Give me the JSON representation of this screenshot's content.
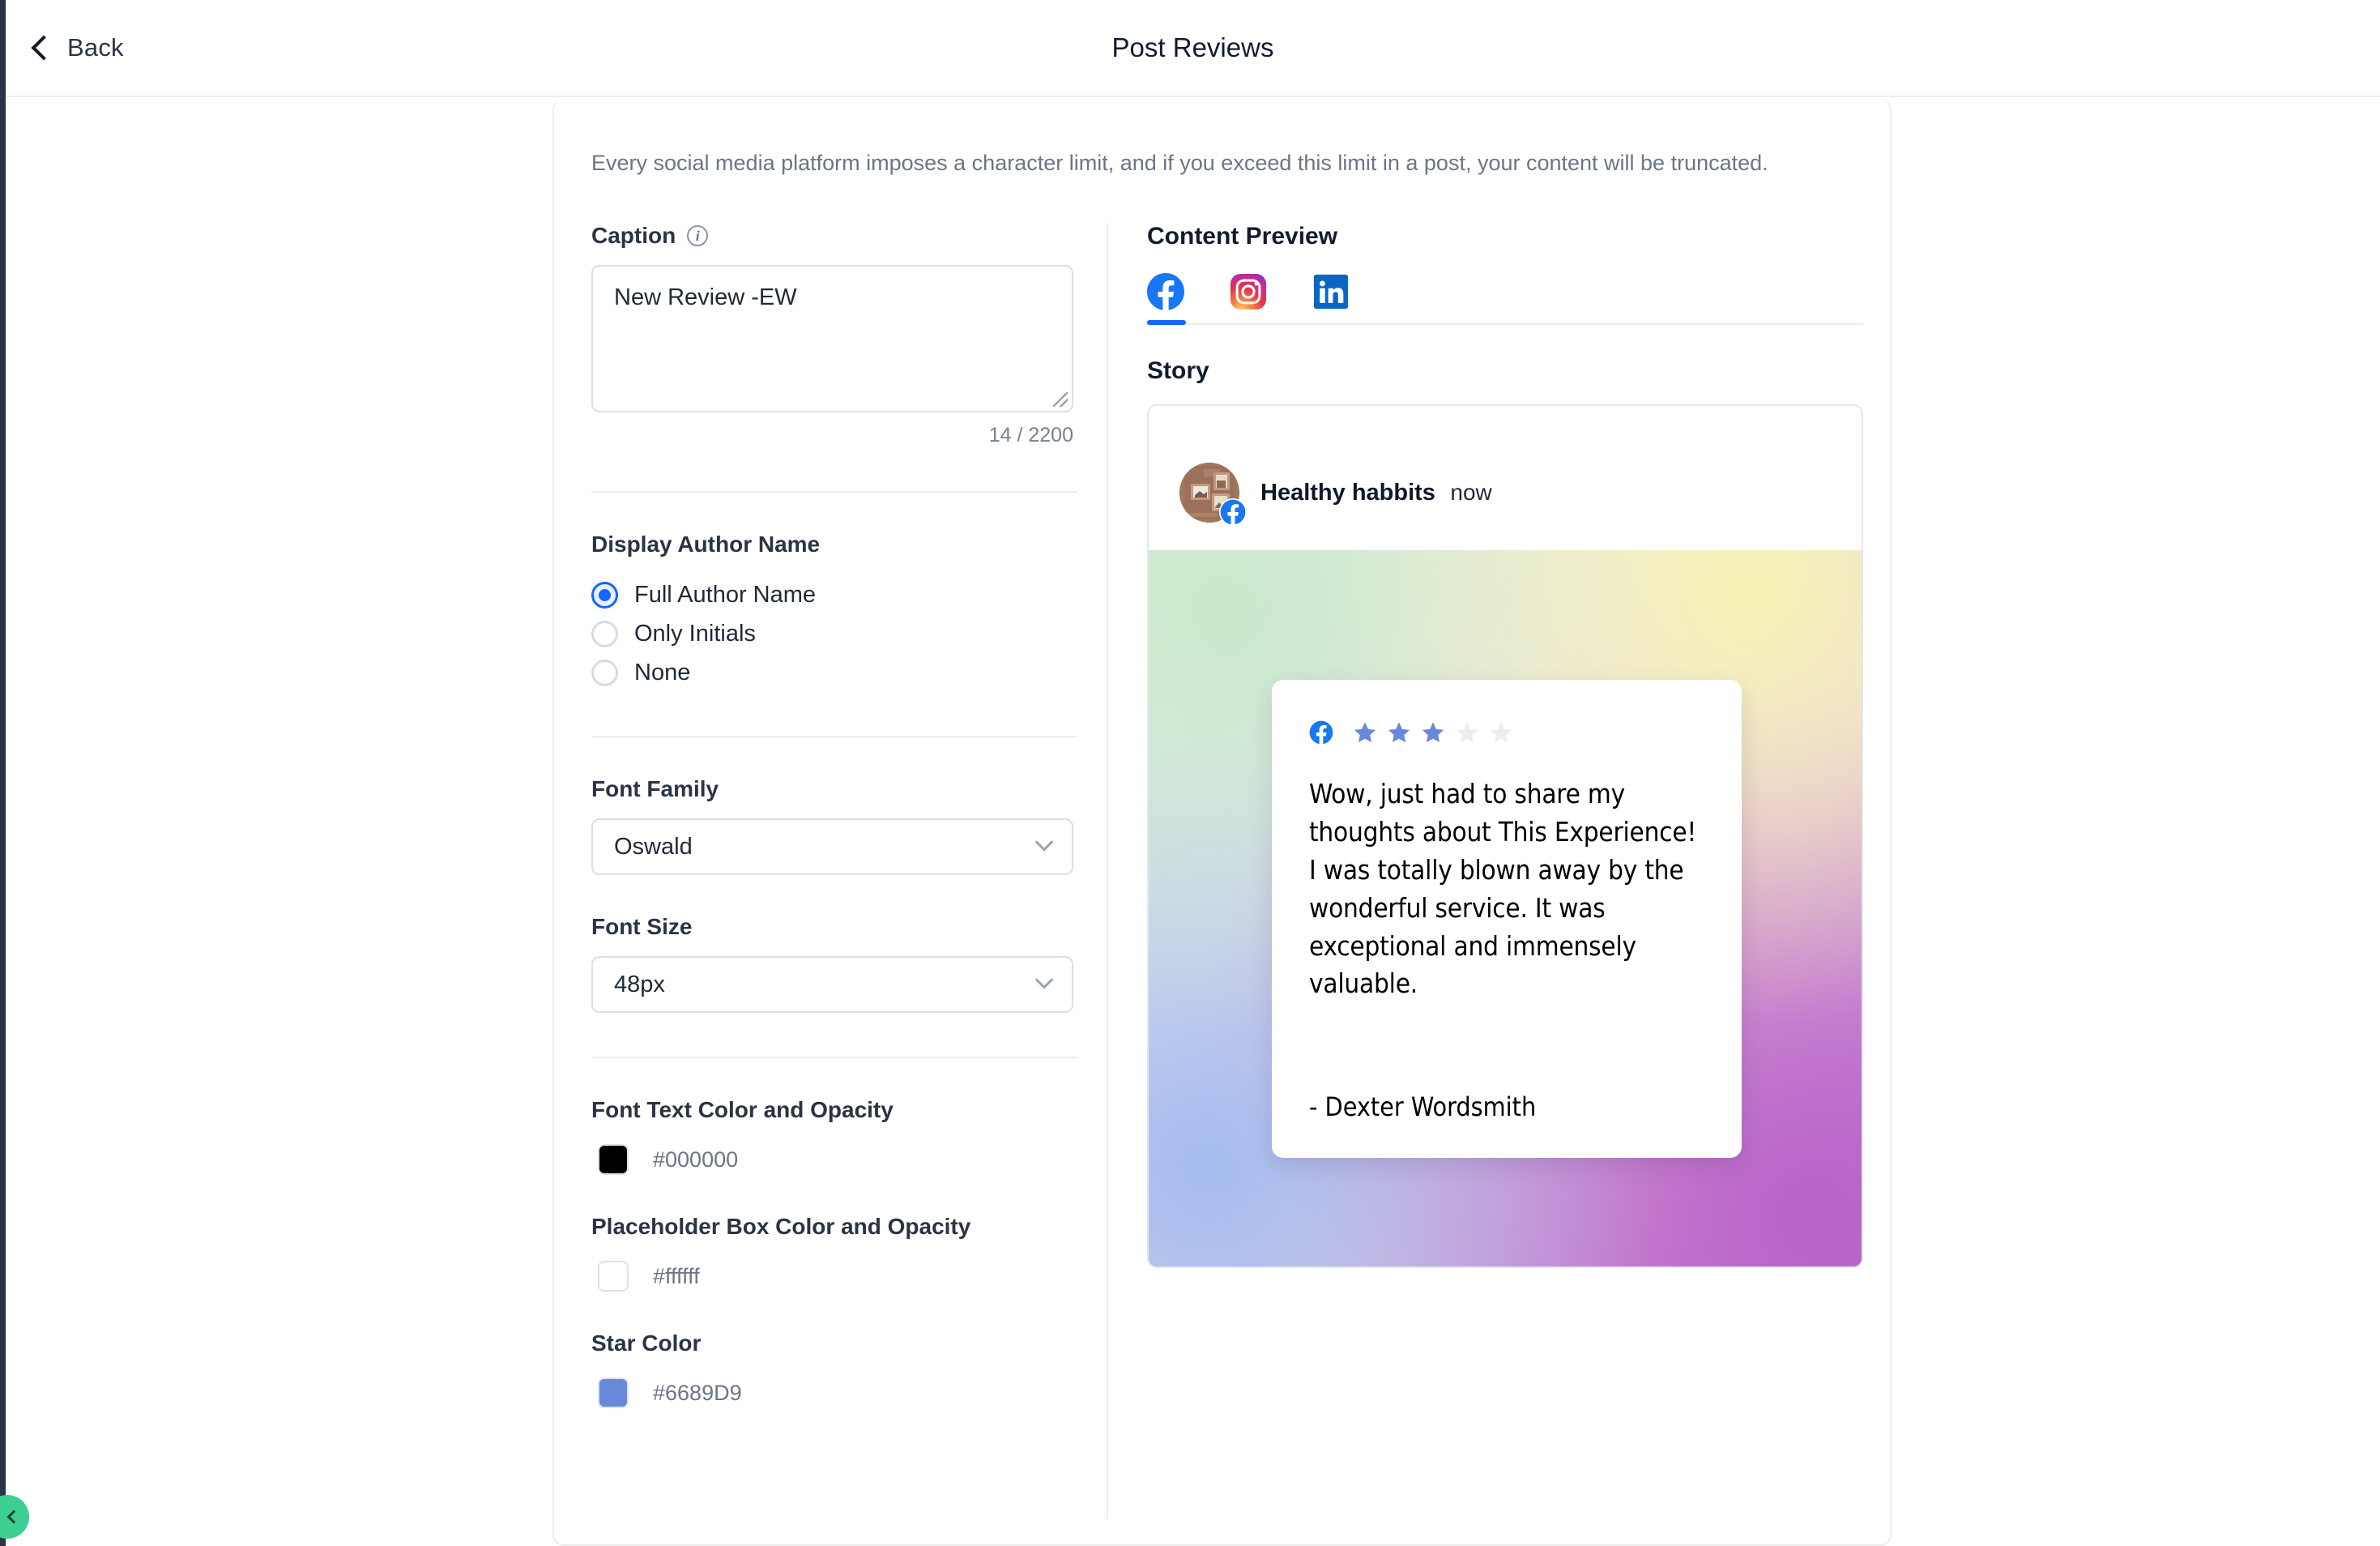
{
  "topbar": {
    "back_label": "Back",
    "title": "Post Reviews",
    "back_icon": "chevron-left-icon"
  },
  "notice": "Every social media platform imposes a character limit, and if you exceed this limit in a post, your content will be truncated.",
  "form": {
    "caption": {
      "label": "Caption",
      "info_icon": "info-icon",
      "value": "New Review -EW",
      "placeholder": "",
      "char_count": "14 / 2200"
    },
    "display_author": {
      "label": "Display Author Name",
      "options": [
        {
          "label": "Full Author Name",
          "selected": true
        },
        {
          "label": "Only Initials",
          "selected": false
        },
        {
          "label": "None",
          "selected": false
        }
      ]
    },
    "font_family": {
      "label": "Font Family",
      "value": "Oswald"
    },
    "font_size": {
      "label": "Font Size",
      "value": "48px"
    },
    "font_text_color": {
      "label": "Font Text Color and Opacity",
      "hex": "#000000",
      "swatch": "#000000"
    },
    "placeholder_box_color": {
      "label": "Placeholder Box Color and Opacity",
      "hex": "#ffffff",
      "swatch": "#ffffff"
    },
    "star_color": {
      "label": "Star Color",
      "hex": "#6689D9",
      "swatch": "#6689D9"
    }
  },
  "preview": {
    "title": "Content Preview",
    "tabs": [
      {
        "name": "facebook-icon",
        "active": true
      },
      {
        "name": "instagram-icon",
        "active": false
      },
      {
        "name": "linkedin-icon",
        "active": false
      }
    ],
    "story_label": "Story",
    "story": {
      "account_name": "Healthy habbits",
      "time": "now",
      "platform_badge": "facebook-badge-icon",
      "review": {
        "platform_icon": "facebook-icon",
        "rating": 3,
        "max_rating": 5,
        "text": "Wow, just had to share my thoughts about This Experience! I was totally blown away by the wonderful service. It was exceptional and immensely valuable.",
        "author": "- Dexter Wordsmith",
        "star_filled_color": "#6689D9",
        "star_empty_color": "#ECEDF1",
        "card_bg": "#ffffff",
        "text_color": "#000000"
      }
    }
  },
  "float_button": {
    "name": "collapse-sidebar-button",
    "color": "#3ccf91"
  }
}
